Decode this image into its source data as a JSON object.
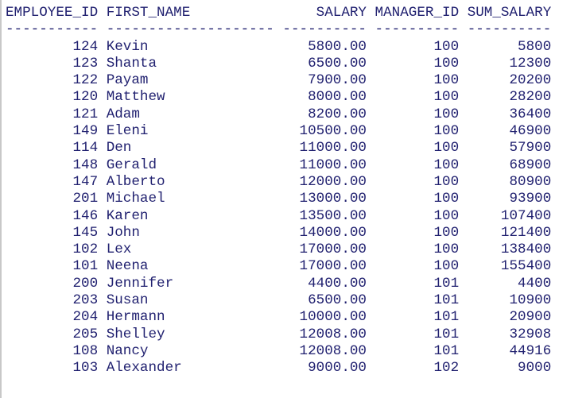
{
  "terminal": {
    "type": "sql-query-result",
    "text_color": "#212170",
    "background_color": "#ffffff"
  },
  "table": {
    "columns": [
      {
        "key": "employee_id",
        "header": "EMPLOYEE_ID",
        "width": 11,
        "align": "right",
        "rule": "-----------"
      },
      {
        "key": "first_name",
        "header": "FIRST_NAME",
        "width": 20,
        "align": "left",
        "rule": "--------------------"
      },
      {
        "key": "salary",
        "header": "SALARY",
        "width": 10,
        "align": "right",
        "rule": "----------"
      },
      {
        "key": "manager_id",
        "header": "MANAGER_ID",
        "width": 10,
        "align": "right",
        "rule": "----------"
      },
      {
        "key": "sum_salary",
        "header": "SUM_SALARY",
        "width": 10,
        "align": "right",
        "rule": "----------"
      }
    ],
    "rows": [
      {
        "employee_id": "124",
        "first_name": "Kevin",
        "salary": "5800.00",
        "manager_id": "100",
        "sum_salary": "5800"
      },
      {
        "employee_id": "123",
        "first_name": "Shanta",
        "salary": "6500.00",
        "manager_id": "100",
        "sum_salary": "12300"
      },
      {
        "employee_id": "122",
        "first_name": "Payam",
        "salary": "7900.00",
        "manager_id": "100",
        "sum_salary": "20200"
      },
      {
        "employee_id": "120",
        "first_name": "Matthew",
        "salary": "8000.00",
        "manager_id": "100",
        "sum_salary": "28200"
      },
      {
        "employee_id": "121",
        "first_name": "Adam",
        "salary": "8200.00",
        "manager_id": "100",
        "sum_salary": "36400"
      },
      {
        "employee_id": "149",
        "first_name": "Eleni",
        "salary": "10500.00",
        "manager_id": "100",
        "sum_salary": "46900"
      },
      {
        "employee_id": "114",
        "first_name": "Den",
        "salary": "11000.00",
        "manager_id": "100",
        "sum_salary": "57900"
      },
      {
        "employee_id": "148",
        "first_name": "Gerald",
        "salary": "11000.00",
        "manager_id": "100",
        "sum_salary": "68900"
      },
      {
        "employee_id": "147",
        "first_name": "Alberto",
        "salary": "12000.00",
        "manager_id": "100",
        "sum_salary": "80900"
      },
      {
        "employee_id": "201",
        "first_name": "Michael",
        "salary": "13000.00",
        "manager_id": "100",
        "sum_salary": "93900"
      },
      {
        "employee_id": "146",
        "first_name": "Karen",
        "salary": "13500.00",
        "manager_id": "100",
        "sum_salary": "107400"
      },
      {
        "employee_id": "145",
        "first_name": "John",
        "salary": "14000.00",
        "manager_id": "100",
        "sum_salary": "121400"
      },
      {
        "employee_id": "102",
        "first_name": "Lex",
        "salary": "17000.00",
        "manager_id": "100",
        "sum_salary": "138400"
      },
      {
        "employee_id": "101",
        "first_name": "Neena",
        "salary": "17000.00",
        "manager_id": "100",
        "sum_salary": "155400"
      },
      {
        "employee_id": "200",
        "first_name": "Jennifer",
        "salary": "4400.00",
        "manager_id": "101",
        "sum_salary": "4400"
      },
      {
        "employee_id": "203",
        "first_name": "Susan",
        "salary": "6500.00",
        "manager_id": "101",
        "sum_salary": "10900"
      },
      {
        "employee_id": "204",
        "first_name": "Hermann",
        "salary": "10000.00",
        "manager_id": "101",
        "sum_salary": "20900"
      },
      {
        "employee_id": "205",
        "first_name": "Shelley",
        "salary": "12008.00",
        "manager_id": "101",
        "sum_salary": "32908"
      },
      {
        "employee_id": "108",
        "first_name": "Nancy",
        "salary": "12008.00",
        "manager_id": "101",
        "sum_salary": "44916"
      },
      {
        "employee_id": "103",
        "first_name": "Alexander",
        "salary": "9000.00",
        "manager_id": "102",
        "sum_salary": "9000"
      }
    ]
  }
}
